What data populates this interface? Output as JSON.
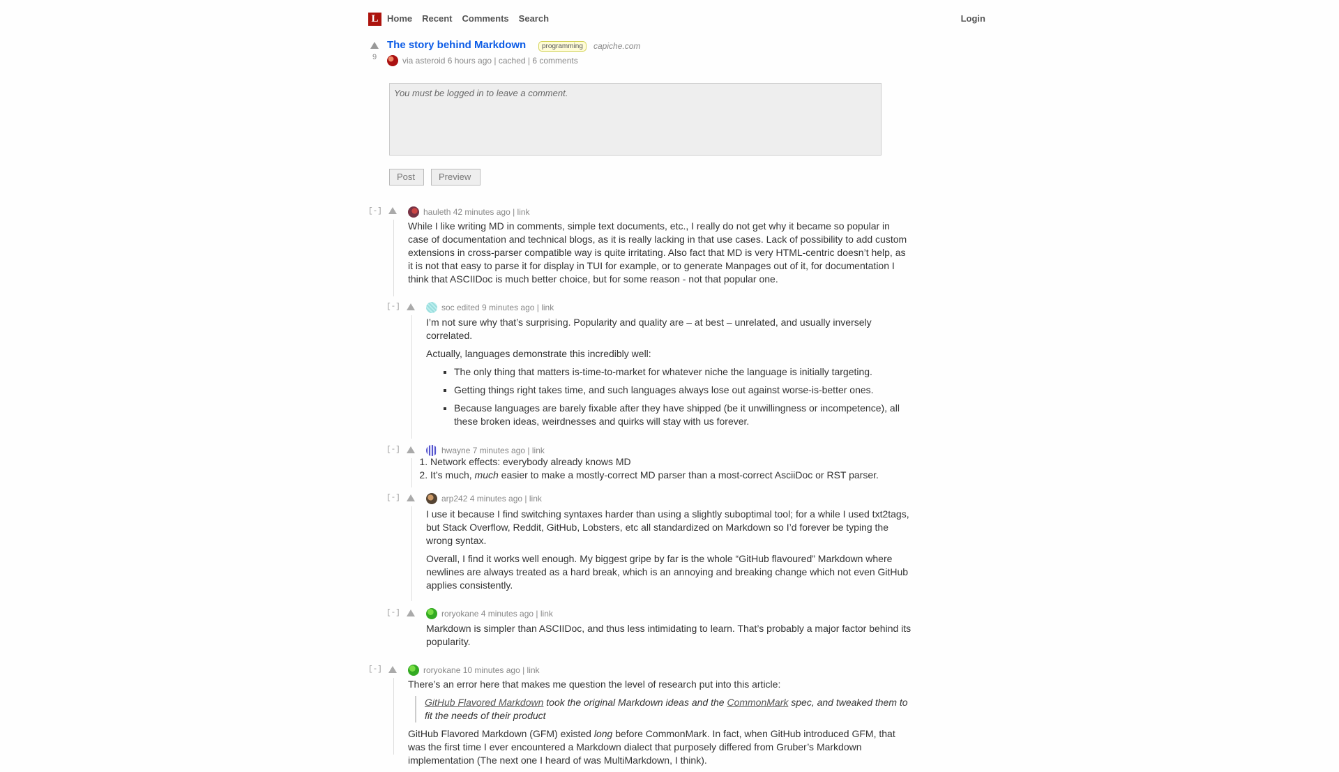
{
  "header": {
    "logo": "L",
    "nav": [
      "Home",
      "Recent",
      "Comments",
      "Search"
    ],
    "login": "Login"
  },
  "story": {
    "score": "9",
    "title": "The story behind Markdown",
    "tag": "programming",
    "domain": "capiche.com",
    "byline": "via asteroid 6 hours ago | cached | 6 comments"
  },
  "comment_form": {
    "placeholder": "You must be logged in to leave a comment.",
    "post": "Post",
    "preview": "Preview"
  },
  "comments": [
    {
      "toggle": "[-]",
      "meta": "hauleth 42 minutes ago | link",
      "p1": "While I like writing MD in comments, simple text documents, etc., I really do not get why it became so popular in case of documentation and technical blogs, as it is really lacking in that use cases. Lack of possibility to add custom extensions in cross-parser compatible way is quite irritating. Also fact that MD is very HTML-centric doesn’t help, as it is not that easy to parse it for display in TUI for example, or to generate Manpages out of it, for documentation I think that ASCIIDoc is much better choice, but for some reason - not that popular one."
    },
    {
      "toggle": "[-]",
      "meta": "soc edited 9 minutes ago | link",
      "p1": "I’m not sure why that’s surprising. Popularity and quality are – at best – unrelated, and usually inversely correlated.",
      "p2": "Actually, languages demonstrate this incredibly well:",
      "items": [
        "The only thing that matters is-time-to-market for whatever niche the language is initially targeting.",
        "Getting things right takes time, and such languages always lose out against worse-is-better ones.",
        "Because languages are barely fixable after they have shipped (be it unwillingness or incompetence), all these broken ideas, weirdnesses and quirks will stay with us forever."
      ]
    },
    {
      "toggle": "[-]",
      "meta": "hwayne 7 minutes ago | link",
      "items": [
        "Network effects: everybody already knows MD",
        "It’s much, ",
        "much",
        " easier to make a mostly-correct MD parser than a most-correct AsciiDoc or RST parser."
      ]
    },
    {
      "toggle": "[-]",
      "meta": "arp242 4 minutes ago | link",
      "p1": "I use it because I find switching syntaxes harder than using a slightly suboptimal tool; for a while I used txt2tags, but Stack Overflow, Reddit, GitHub, Lobsters, etc all standardized on Markdown so I’d forever be typing the wrong syntax.",
      "p2": "Overall, I find it works well enough. My biggest gripe by far is the whole “GitHub flavoured” Markdown where newlines are always treated as a hard break, which is an annoying and breaking change which not even GitHub applies consistently."
    },
    {
      "toggle": "[-]",
      "meta": "roryokane 4 minutes ago | link",
      "p1": "Markdown is simpler than ASCIIDoc, and thus less intimidating to learn. That’s probably a major factor behind its popularity."
    },
    {
      "toggle": "[-]",
      "meta": "roryokane 10 minutes ago | link",
      "p1": "There’s an error here that makes me question the level of research put into this article:",
      "quote_link1": "GitHub Flavored Markdown",
      "quote_mid": " took the original Markdown ideas and the ",
      "quote_link2": "CommonMark",
      "quote_end": " spec, and tweaked them to fit the needs of their product",
      "p2a": "GitHub Flavored Markdown (GFM) existed ",
      "p2em": "long",
      "p2b": " before CommonMark. In fact, when GitHub introduced GFM, that was the first time I ever encountered a Markdown dialect that purposely differed from Gruber’s Markdown implementation (The next one I heard of was MultiMarkdown, I think)."
    }
  ]
}
